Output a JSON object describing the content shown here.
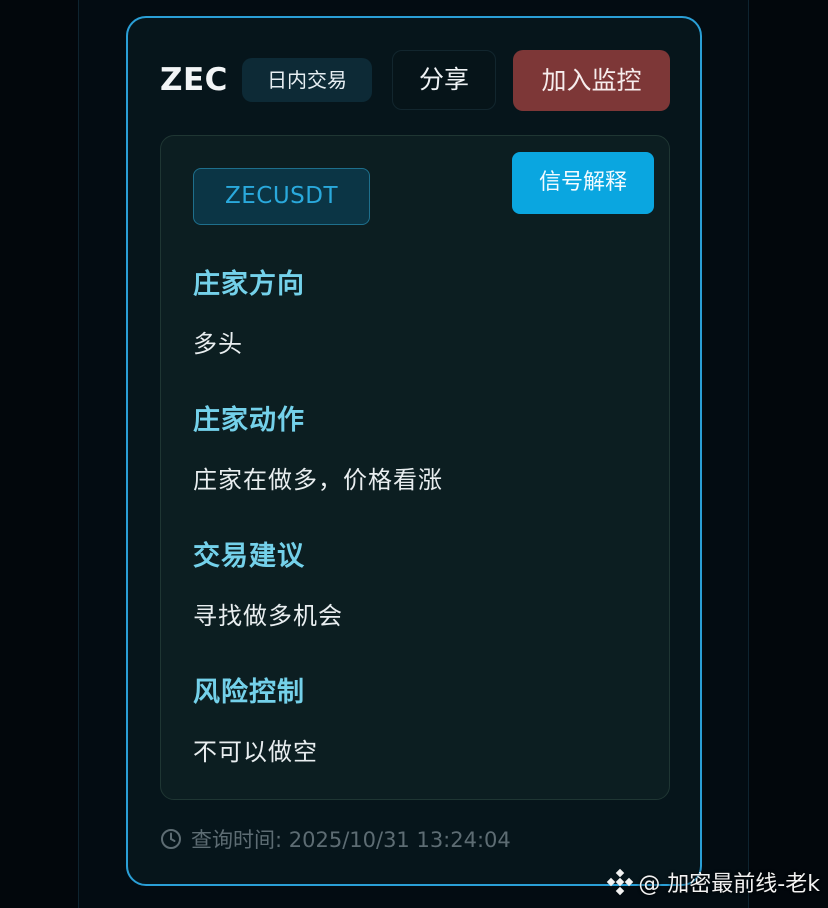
{
  "card": {
    "coin": "ZEC",
    "mode": "日内交易",
    "share_label": "分享",
    "monitor_label": "加入监控"
  },
  "panel": {
    "symbol": "ZECUSDT",
    "explain_label": "信号解释",
    "sections": [
      {
        "title": "庄家方向",
        "value": "多头"
      },
      {
        "title": "庄家动作",
        "value": "庄家在做多，价格看涨"
      },
      {
        "title": "交易建议",
        "value": "寻找做多机会"
      },
      {
        "title": "风险控制",
        "value": "不可以做空"
      }
    ]
  },
  "footer": {
    "query_time": "查询时间: 2025/10/31 13:24:04"
  },
  "watermark": {
    "text": "@ 加密最前线-老k"
  },
  "colors": {
    "border_accent": "#2a9fd6",
    "monitor_button": "#7d3737",
    "explain_button": "#0aa6e0",
    "section_title": "#74d1ea"
  },
  "icons": {
    "clock": "clock-icon",
    "logo": "binance-square-icon"
  }
}
